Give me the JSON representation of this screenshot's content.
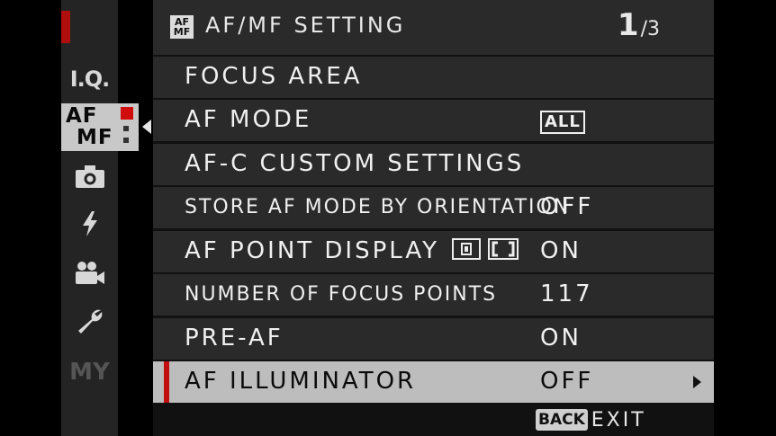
{
  "sidebar": {
    "tabs": [
      {
        "id": "iq",
        "label": "I.Q."
      },
      {
        "id": "afmf",
        "label_top": "AF",
        "label_bottom": "MF"
      },
      {
        "id": "camera",
        "icon": "camera-icon"
      },
      {
        "id": "flash",
        "icon": "flash-icon"
      },
      {
        "id": "movie",
        "icon": "movie-camera-icon"
      },
      {
        "id": "setup",
        "icon": "wrench-icon"
      },
      {
        "id": "my",
        "label": "MY"
      }
    ]
  },
  "header": {
    "icon_top": "AF",
    "icon_bottom": "MF",
    "title": "AF/MF SETTING",
    "page_current": "1",
    "page_total": "/3"
  },
  "menu": {
    "items": [
      {
        "label": "FOCUS AREA",
        "value": ""
      },
      {
        "label": "AF MODE",
        "value": "ALL"
      },
      {
        "label": "AF-C CUSTOM SETTINGS",
        "value": ""
      },
      {
        "label": "STORE AF MODE BY ORIENTATION",
        "value": "OFF"
      },
      {
        "label": "AF POINT DISPLAY",
        "value": "ON"
      },
      {
        "label": "NUMBER OF FOCUS POINTS",
        "value": "117"
      },
      {
        "label": "PRE-AF",
        "value": "ON"
      },
      {
        "label": "AF ILLUMINATOR",
        "value": "OFF"
      }
    ]
  },
  "footer": {
    "back_label": "BACK",
    "exit_label": "EXIT"
  },
  "colors": {
    "accent": "#c21010",
    "selected_row": "#bdbdbd",
    "row_bg": "#2a2a2a"
  }
}
